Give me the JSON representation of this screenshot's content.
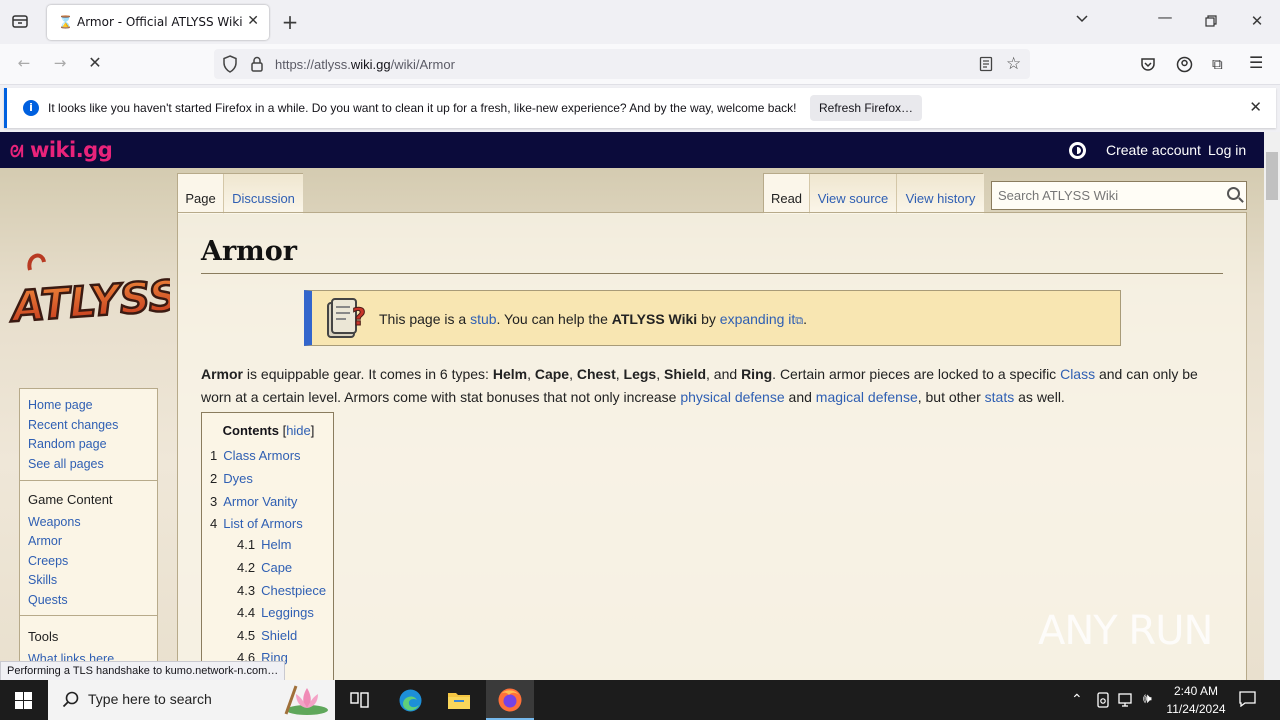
{
  "browser": {
    "tab_title": "Armor - Official ATLYSS Wiki",
    "url_prefix": "https://atlyss.",
    "url_domain": "wiki.gg",
    "url_path": "/wiki/Armor",
    "notification": "It looks like you haven't started Firefox in a while. Do you want to clean it up for a fresh, like-new experience? And by the way, welcome back!",
    "notification_button": "Refresh Firefox…",
    "status": "Performing a TLS handshake to kumo.network-n.com…"
  },
  "wiki": {
    "brand": "wiki.gg",
    "create_account": "Create account",
    "log_in": "Log in",
    "game_logo": "ATLYSS",
    "tabs_left": [
      "Page",
      "Discussion"
    ],
    "tabs_right": [
      "Read",
      "View source",
      "View history"
    ],
    "search_placeholder": "Search ATLYSS Wiki",
    "nav_links": [
      "Home page",
      "Recent changes",
      "Random page",
      "See all pages"
    ],
    "game_content_heading": "Game Content",
    "game_content_links": [
      "Weapons",
      "Armor",
      "Creeps",
      "Skills",
      "Quests"
    ],
    "tools_heading": "Tools",
    "tools_links": [
      "What links here"
    ]
  },
  "article": {
    "title": "Armor",
    "stub": {
      "pre": "This page is a ",
      "stub_link": "stub",
      "mid": ". You can help the ",
      "wiki_name": "ATLYSS Wiki",
      "by": " by ",
      "expand_link": "expanding it",
      "end": "."
    },
    "intro": {
      "armor": "Armor",
      "t1": " is equippable gear. It comes in 6 types: ",
      "helm": "Helm",
      "cape": "Cape",
      "chest": "Chest",
      "legs": "Legs",
      "shield": "Shield",
      "and": ", and ",
      "ring": "Ring",
      "t2": ". Certain armor pieces are locked to a specific ",
      "class_link": "Class",
      "t3": " and can only be worn at a certain level. Armors come with stat bonuses that not only increase ",
      "phys_link": "physical defense",
      "t4": " and ",
      "mag_link": "magical defense",
      "t5": ", but other ",
      "stats_link": "stats",
      "t6": " as well."
    },
    "toc": {
      "title": "Contents",
      "hide": "hide",
      "items": [
        {
          "num": "1",
          "label": "Class Armors"
        },
        {
          "num": "2",
          "label": "Dyes"
        },
        {
          "num": "3",
          "label": "Armor Vanity"
        },
        {
          "num": "4",
          "label": "List of Armors"
        },
        {
          "num": "4.1",
          "label": "Helm"
        },
        {
          "num": "4.2",
          "label": "Cape"
        },
        {
          "num": "4.3",
          "label": "Chestpiece"
        },
        {
          "num": "4.4",
          "label": "Leggings"
        },
        {
          "num": "4.5",
          "label": "Shield"
        },
        {
          "num": "4.6",
          "label": "Ring"
        }
      ]
    }
  },
  "watermark": "ANY RUN",
  "taskbar": {
    "search_placeholder": "Type here to search",
    "time": "2:40 AM",
    "date": "11/24/2024"
  }
}
